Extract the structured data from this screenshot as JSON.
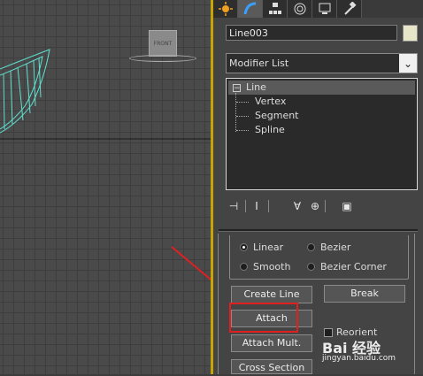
{
  "viewport": {
    "viewcube_label": "FRONT"
  },
  "command_panel": {
    "tabs": [
      {
        "icon": "sun-create-icon",
        "color": "#f0a020"
      },
      {
        "icon": "modify-arc-icon",
        "color": "#3aa0ff"
      },
      {
        "icon": "hierarchy-icon",
        "color": "#dddddd"
      },
      {
        "icon": "motion-icon",
        "color": "#dddddd"
      },
      {
        "icon": "display-icon",
        "color": "#dddddd"
      },
      {
        "icon": "utilities-hammer-icon",
        "color": "#dddddd"
      }
    ],
    "object_name": "Line003",
    "object_color": "#e8e6c8",
    "modifier_list_label": "Modifier List",
    "stack": {
      "root": "Line",
      "children": [
        "Vertex",
        "Segment",
        "Spline"
      ]
    }
  },
  "creation_method": {
    "initial_type": {
      "linear": "Linear",
      "bezier": "Bezier"
    },
    "drag_type": {
      "smooth": "Smooth",
      "bezier_corner": "Bezier Corner"
    }
  },
  "geometry": {
    "create_line": "Create Line",
    "break": "Break",
    "attach": "Attach",
    "reorient": "Reorient",
    "attach_mult": "Attach Mult.",
    "cross_section": "Cross Section"
  },
  "watermark": {
    "brand": "Bai 经验",
    "url": "jingyan.baidu.com"
  },
  "colors": {
    "highlight": "#e02020",
    "viewport_active_border": "#c9a400"
  }
}
